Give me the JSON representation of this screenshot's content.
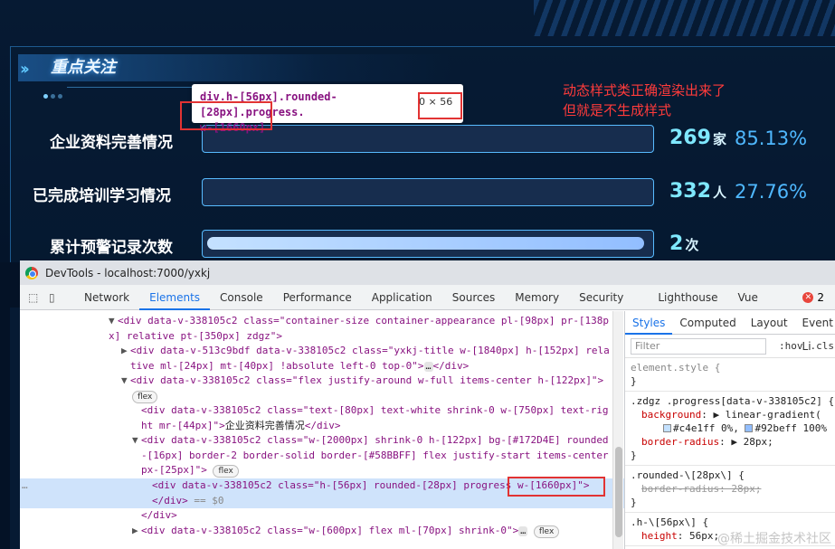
{
  "dashboard": {
    "section_title": "重点关注",
    "rows": [
      {
        "label": "企业资料完善情况",
        "count": "269",
        "unit": "家",
        "percent": "85.13%",
        "fill_fraction": 0
      },
      {
        "label": "已完成培训学习情况",
        "count": "332",
        "unit": "人",
        "percent": "27.76%",
        "fill_fraction": 0
      },
      {
        "label": "累计预警记录次数",
        "count": "2",
        "unit": "次",
        "percent": "",
        "fill_fraction": 0.99
      }
    ],
    "tooltip": {
      "selector_line1": "div.h-[56px].rounded-[28px].progress.",
      "selector_line2": "w-[1660px]",
      "size": "0 × 56"
    },
    "annotation": {
      "line1": "动态样式类正确渲染出来了",
      "line2": "但就是不生成样式"
    }
  },
  "devtools": {
    "window_title": "DevTools - localhost:7000/yxkj",
    "tabs": [
      "Network",
      "Elements",
      "Console",
      "Performance",
      "Application",
      "Sources",
      "Memory",
      "Security",
      "Lighthouse",
      "Vue"
    ],
    "active_tab": "Elements",
    "error_count": "2",
    "dom_lines": {
      "l1": "<div data-v-338105c2 class=\"container-size container-appearance pl-[98px] pr-[138p",
      "l2": "x] relative pt-[350px] zdgz\">",
      "l3": "<div data-v-513c9bdf data-v-338105c2 class=\"yxkj-title w-[1840px] h-[152px] rela",
      "l4a": "tive ml-[24px] mt-[40px] !absolute left-0 top-0\">",
      "l4b": "</div>",
      "l5": "<div data-v-338105c2 class=\"flex justify-around w-full items-center h-[122px]\">",
      "l6": "flex",
      "l7": "<div data-v-338105c2 class=\"text-[80px] text-white shrink-0 w-[750px] text-rig",
      "l8a": "ht mr-[44px]\">",
      "l8b": "企业资料完善情况",
      "l8c": "</div>",
      "l9": "<div data-v-338105c2 class=\"w-[2000px] shrink-0 h-[122px] bg-[#172D4E] rounded",
      "l10": "-[16px] border-2 border-solid border-[#58BBFF] flex justify-start items-center",
      "l11a": "px-[25px]\">",
      "l11b": "flex",
      "l12a": "<div data-v-338105c2 class=\"h-[56px] rounded-[28px] progress ",
      "l12b": "w-[1660px]\">",
      "l13a": "</div>",
      "l13b": "== $0",
      "l14": "</div>",
      "l15": "<div data-v-338105c2 class=\"w-[600px] flex ml-[70px] shrink-0\">",
      "l15b": "flex",
      "ellipsis": "…",
      "ghost": "…"
    },
    "styles": {
      "tabs": [
        "Styles",
        "Computed",
        "Layout",
        "Event Li"
      ],
      "active_tab": "Styles",
      "filter_placeholder": "Filter",
      "hov": ":hov",
      "cls": ".cls",
      "element_style": "element.style {",
      "close": "}",
      "rule1_selector": ".zdgz .progress[data-v-338105c2] {",
      "rule1_bg_name": "background",
      "rule1_bg_value": "linear-gradient(",
      "rule1_stop1": "#c4e1ff 0%,",
      "rule1_stop2": "#92beff 100%",
      "rule1_radius_name": "border-radius",
      "rule1_radius_value": "28px;",
      "rule2_selector": ".rounded-\\[28px\\] {",
      "rule2_decl": "border-radius: 28px;",
      "rule3_selector": ".h-\\[56px\\] {",
      "rule3_name": "height",
      "rule3_value": "56px;"
    },
    "watermark": "@稀土掘金技术社区"
  },
  "colors": {
    "accent": "#1a73e8",
    "bar_border": "#58BBFF",
    "bar_bg": "#172D4E",
    "grad_start": "#c4e1ff",
    "grad_end": "#92beff",
    "annotation": "#ff3b3b"
  }
}
